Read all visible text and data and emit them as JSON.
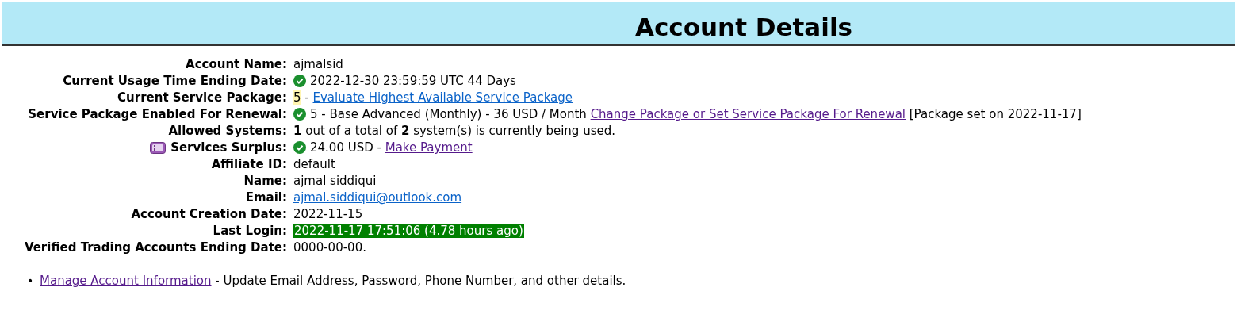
{
  "title": "Account Details",
  "rows": [
    {
      "label": "Account Name:",
      "verified": false,
      "info": false,
      "parts": [
        {
          "kind": "text",
          "text": "ajmalsid"
        }
      ]
    },
    {
      "label": "Current Usage Time Ending Date:",
      "verified": true,
      "info": false,
      "parts": [
        {
          "kind": "text",
          "text": "2022-12-30 23:59:59 UTC 44 Days"
        }
      ]
    },
    {
      "label": "Current Service Package:",
      "verified": false,
      "info": false,
      "parts": [
        {
          "kind": "highlight",
          "text": "5"
        },
        {
          "kind": "text",
          "text": " - "
        },
        {
          "kind": "link",
          "text": "Evaluate Highest Available Service Package",
          "visited": false
        }
      ]
    },
    {
      "label": "Service Package Enabled For Renewal:",
      "verified": true,
      "info": false,
      "parts": [
        {
          "kind": "text",
          "text": "5 - Base Advanced (Monthly) - 36 USD / Month "
        },
        {
          "kind": "link",
          "text": "Change Package or Set Service Package For Renewal",
          "visited": true
        },
        {
          "kind": "text",
          "text": " [Package set on 2022-11-17]"
        }
      ]
    },
    {
      "label": "Allowed Systems:",
      "verified": false,
      "info": false,
      "parts": [
        {
          "kind": "text",
          "text": "**1** out of a total of **2** system(s) is currently being used."
        }
      ]
    },
    {
      "label": "Services Surplus:",
      "verified": true,
      "info": true,
      "parts": [
        {
          "kind": "text",
          "text": "24.00 USD - "
        },
        {
          "kind": "link",
          "text": "Make Payment",
          "visited": true
        }
      ]
    },
    {
      "label": "Affiliate ID:",
      "verified": false,
      "info": false,
      "parts": [
        {
          "kind": "text",
          "text": "default"
        }
      ]
    },
    {
      "label": "Name:",
      "verified": false,
      "info": false,
      "parts": [
        {
          "kind": "text",
          "text": "ajmal siddiqui"
        }
      ]
    },
    {
      "label": "Email:",
      "verified": false,
      "info": false,
      "parts": [
        {
          "kind": "link",
          "text": "ajmal.siddiqui@outlook.com",
          "visited": false
        }
      ]
    },
    {
      "label": "Account Creation Date:",
      "verified": false,
      "info": false,
      "parts": [
        {
          "kind": "text",
          "text": "2022-11-15"
        }
      ]
    },
    {
      "label": "Last Login:",
      "verified": false,
      "info": false,
      "parts": [
        {
          "kind": "badge",
          "text": "2022-11-17 17:51:06 (4.78 hours ago)"
        }
      ]
    },
    {
      "label": "Verified Trading Accounts Ending Date:",
      "verified": false,
      "info": false,
      "parts": [
        {
          "kind": "text",
          "text": "0000-00-00."
        }
      ]
    }
  ],
  "links": [
    {
      "marker": "•",
      "link": "Manage Account Information",
      "visited": true,
      "description": " - Update Email Address, Password, Phone Number, and other details."
    }
  ]
}
